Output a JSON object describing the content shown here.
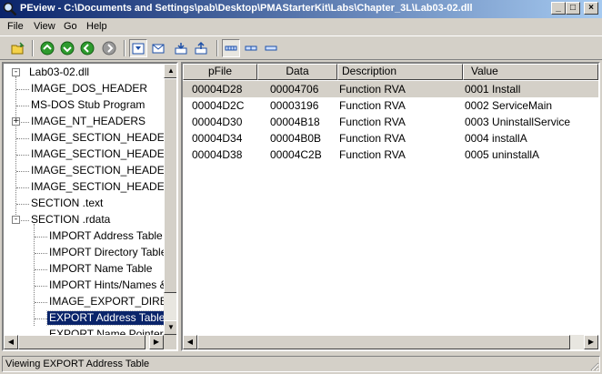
{
  "window": {
    "title": "PEview - C:\\Documents and Settings\\pab\\Desktop\\PMAStarterKit\\Labs\\Chapter_3L\\Lab03-02.dll",
    "minimize": "_",
    "maximize": "□",
    "close": "×"
  },
  "menu": [
    "File",
    "View",
    "Go",
    "Help"
  ],
  "toolbar": {
    "icons": [
      "open-folder-icon",
      "up-icon",
      "down-icon",
      "back-icon",
      "forward-icon",
      "save-icon",
      "mail-icon",
      "import-icon",
      "export-icon",
      "view-byte-icon",
      "view-word-icon",
      "view-dword-icon"
    ]
  },
  "tree": {
    "items": [
      {
        "label": "Lab03-02.dll",
        "level": 0,
        "expander": "-"
      },
      {
        "label": "IMAGE_DOS_HEADER",
        "level": 1,
        "expander": ""
      },
      {
        "label": "MS-DOS Stub Program",
        "level": 1,
        "expander": ""
      },
      {
        "label": "IMAGE_NT_HEADERS",
        "level": 1,
        "expander": "+"
      },
      {
        "label": "IMAGE_SECTION_HEADER .text",
        "level": 1,
        "expander": ""
      },
      {
        "label": "IMAGE_SECTION_HEADER .rdata",
        "level": 1,
        "expander": ""
      },
      {
        "label": "IMAGE_SECTION_HEADER .data",
        "level": 1,
        "expander": ""
      },
      {
        "label": "IMAGE_SECTION_HEADER .reloc",
        "level": 1,
        "expander": ""
      },
      {
        "label": "SECTION .text",
        "level": 1,
        "expander": ""
      },
      {
        "label": "SECTION .rdata",
        "level": 1,
        "expander": "-"
      },
      {
        "label": "IMPORT Address Table",
        "level": 2,
        "expander": ""
      },
      {
        "label": "IMPORT Directory Table",
        "level": 2,
        "expander": ""
      },
      {
        "label": "IMPORT Name Table",
        "level": 2,
        "expander": ""
      },
      {
        "label": "IMPORT Hints/Names & DLL Names",
        "level": 2,
        "expander": ""
      },
      {
        "label": "IMAGE_EXPORT_DIRECTORY",
        "level": 2,
        "expander": ""
      },
      {
        "label": "EXPORT Address Table",
        "level": 2,
        "expander": "",
        "selected": true
      },
      {
        "label": "EXPORT Name Pointer Table",
        "level": 2,
        "expander": ""
      }
    ]
  },
  "list": {
    "columns": [
      "pFile",
      "Data",
      "Description",
      "Value"
    ],
    "rows": [
      {
        "pFile": "00004D28",
        "Data": "00004706",
        "Description": "Function RVA",
        "Value": "0001  Install"
      },
      {
        "pFile": "00004D2C",
        "Data": "00003196",
        "Description": "Function RVA",
        "Value": "0002  ServiceMain"
      },
      {
        "pFile": "00004D30",
        "Data": "00004B18",
        "Description": "Function RVA",
        "Value": "0003  UninstallService"
      },
      {
        "pFile": "00004D34",
        "Data": "00004B0B",
        "Description": "Function RVA",
        "Value": "0004  installA"
      },
      {
        "pFile": "00004D38",
        "Data": "00004C2B",
        "Description": "Function RVA",
        "Value": "0005  uninstallA"
      }
    ]
  },
  "status": {
    "text": "Viewing EXPORT Address Table"
  },
  "colors": {
    "title_start": "#0a246a",
    "title_end": "#a6caf0",
    "selection": "#0a246a",
    "face": "#d4d0c8"
  }
}
